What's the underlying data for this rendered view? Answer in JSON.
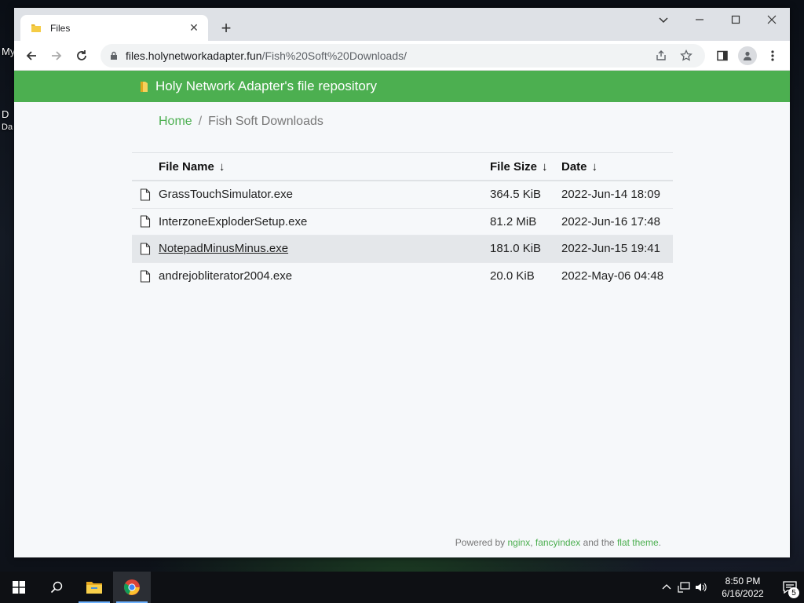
{
  "desktop": {
    "labels": [
      "My",
      "D",
      "Da"
    ]
  },
  "browser": {
    "tab": {
      "title": "Files",
      "favicon": "folder-icon"
    },
    "omnibox": {
      "host": "files.holynetworkadapter.fun",
      "path": "/Fish%20Soft%20Downloads/"
    }
  },
  "page": {
    "header_title": "Holy Network Adapter's file repository",
    "breadcrumb": {
      "home": "Home",
      "separator": "/",
      "current": "Fish Soft Downloads"
    },
    "columns": {
      "name": "File Name",
      "size": "File Size",
      "date": "Date",
      "sort_arrow": "↓"
    },
    "files": [
      {
        "name": "GrassTouchSimulator.exe",
        "size": "364.5 KiB",
        "date": "2022-Jun-14 18:09"
      },
      {
        "name": "InterzoneExploderSetup.exe",
        "size": "81.2 MiB",
        "date": "2022-Jun-16 17:48"
      },
      {
        "name": "NotepadMinusMinus.exe",
        "size": "181.0 KiB",
        "date": "2022-Jun-15 19:41"
      },
      {
        "name": "andrejobliterator2004.exe",
        "size": "20.0 KiB",
        "date": "2022-May-06 04:48"
      }
    ],
    "footer": {
      "prefix": "Powered by ",
      "link1": "nginx",
      "comma": ", ",
      "link2": "fancyindex",
      "middle": " and the ",
      "link3": "flat theme",
      "suffix": "."
    }
  },
  "taskbar": {
    "time": "8:50 PM",
    "date": "6/16/2022",
    "notifications": "5"
  },
  "colors": {
    "header_green": "#4caf50",
    "page_bg": "#f6f8fa",
    "hover_row": "#e4e7ea"
  }
}
